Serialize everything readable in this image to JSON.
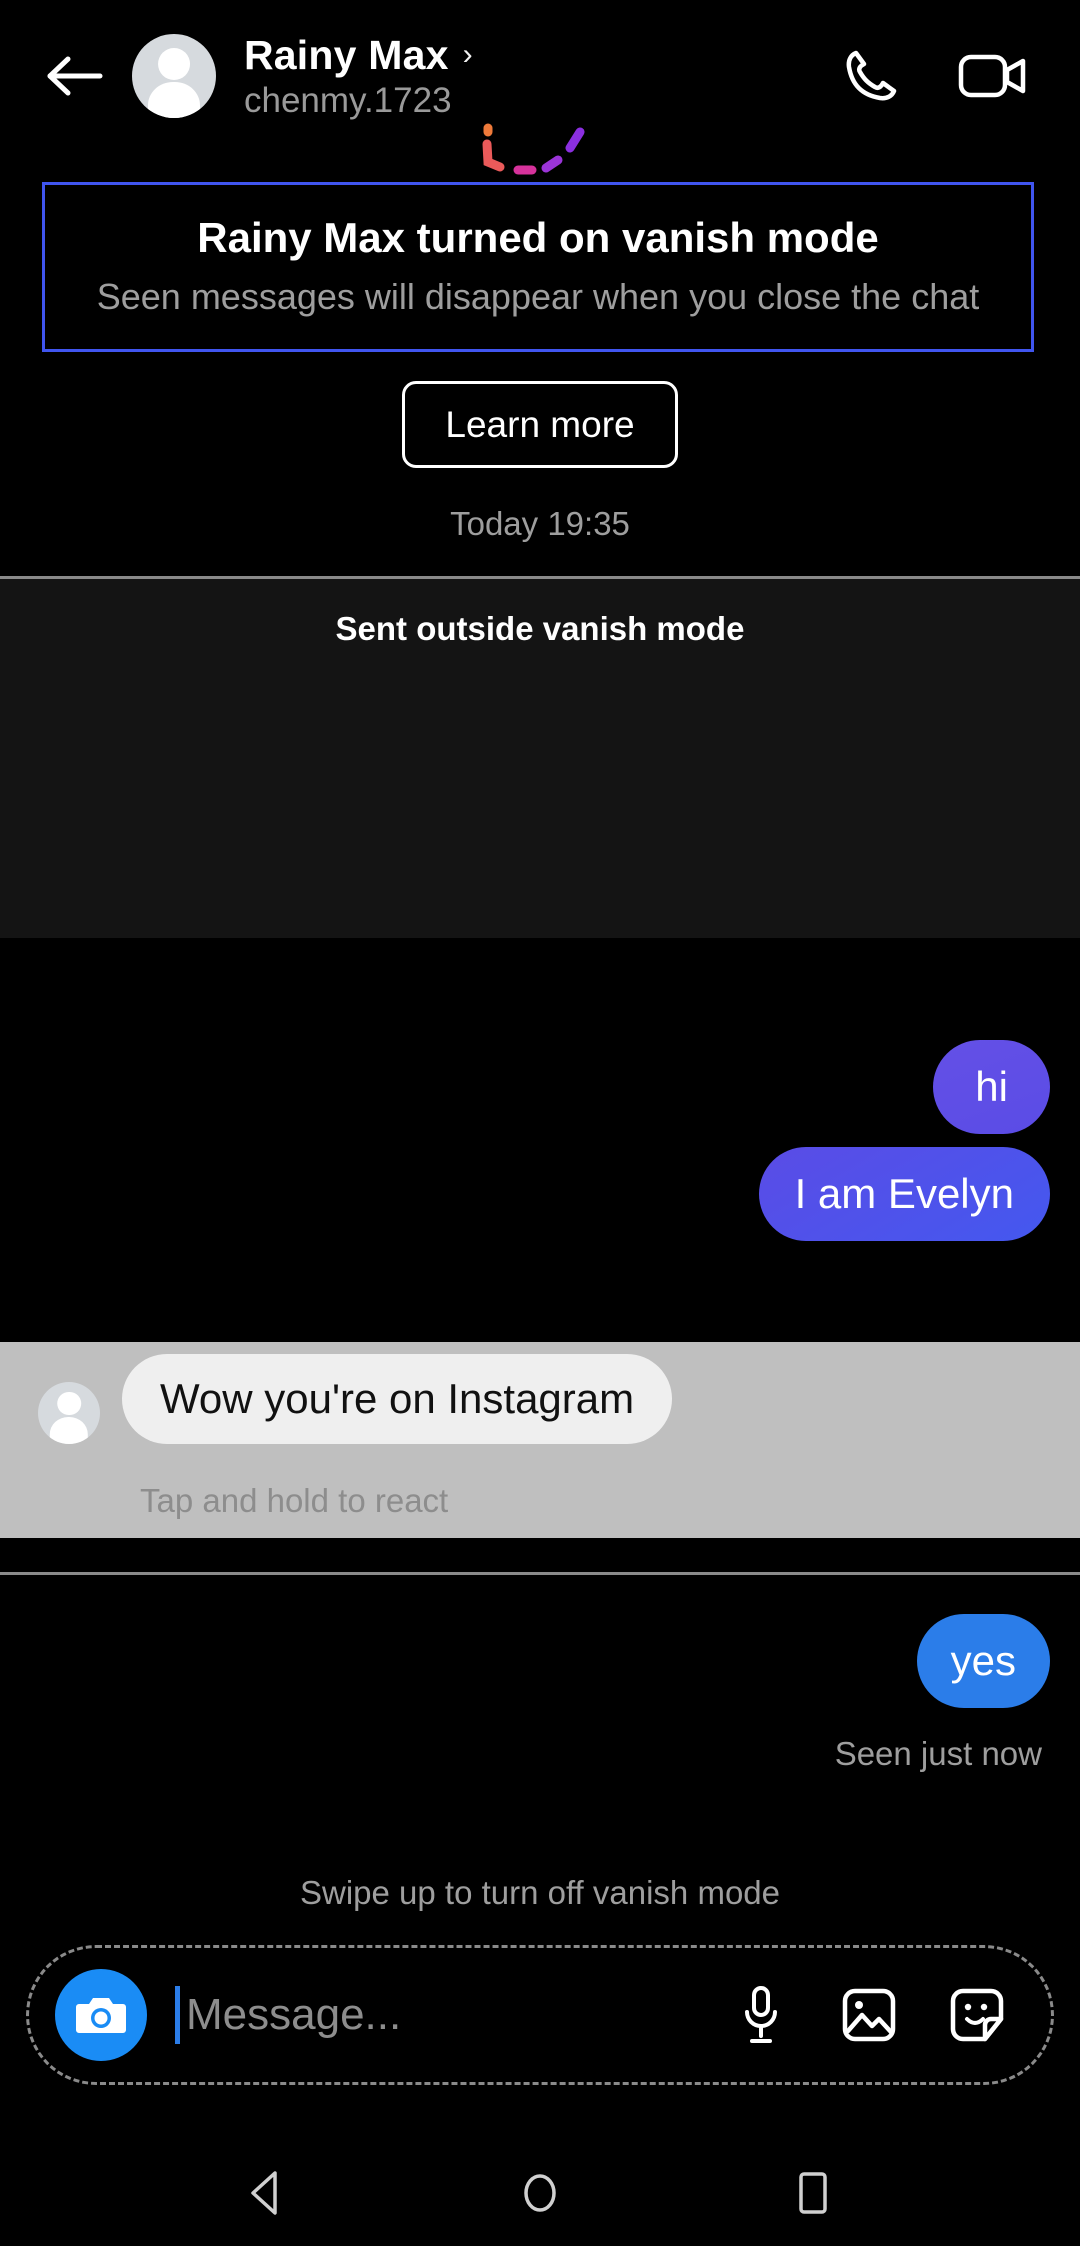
{
  "header": {
    "back_icon": "back-arrow-icon",
    "avatar": "contact-avatar",
    "name": "Rainy Max",
    "chevron": "›",
    "username": "chenmy.1723",
    "call_icon": "phone-call-icon",
    "video_icon": "video-call-icon"
  },
  "vanish": {
    "banner_title": "Rainy Max turned on vanish mode",
    "banner_subtitle": "Seen messages will disappear when you close the chat",
    "learn_more_label": "Learn more",
    "border_color": "#4055ef"
  },
  "timestamp": "Today 19:35",
  "outside_section": {
    "label": "Sent outside vanish mode",
    "background": "#141414"
  },
  "messages": {
    "hi": "hi",
    "evelyn": "I am Evelyn",
    "incoming": "Wow you're on Instagram",
    "react_hint": "Tap and hold to react",
    "yes": "yes",
    "seen_status": "Seen just now",
    "outgoing_color": "#5a4ce6",
    "yes_color": "#2b7de9",
    "incoming_bubble_color": "#efefef",
    "highlight_color": "#bfbfbf"
  },
  "swipe_hint": "Swipe up to turn off vanish mode",
  "composer": {
    "camera_icon": "camera-icon",
    "camera_color": "#1a8cf5",
    "placeholder": "Message...",
    "mic_icon": "microphone-icon",
    "gallery_icon": "gallery-image-icon",
    "sticker_icon": "sticker-smiley-icon"
  },
  "navbar": {
    "back_icon": "nav-back-triangle-icon",
    "home_icon": "nav-home-circle-icon",
    "recents_icon": "nav-recents-square-icon"
  }
}
